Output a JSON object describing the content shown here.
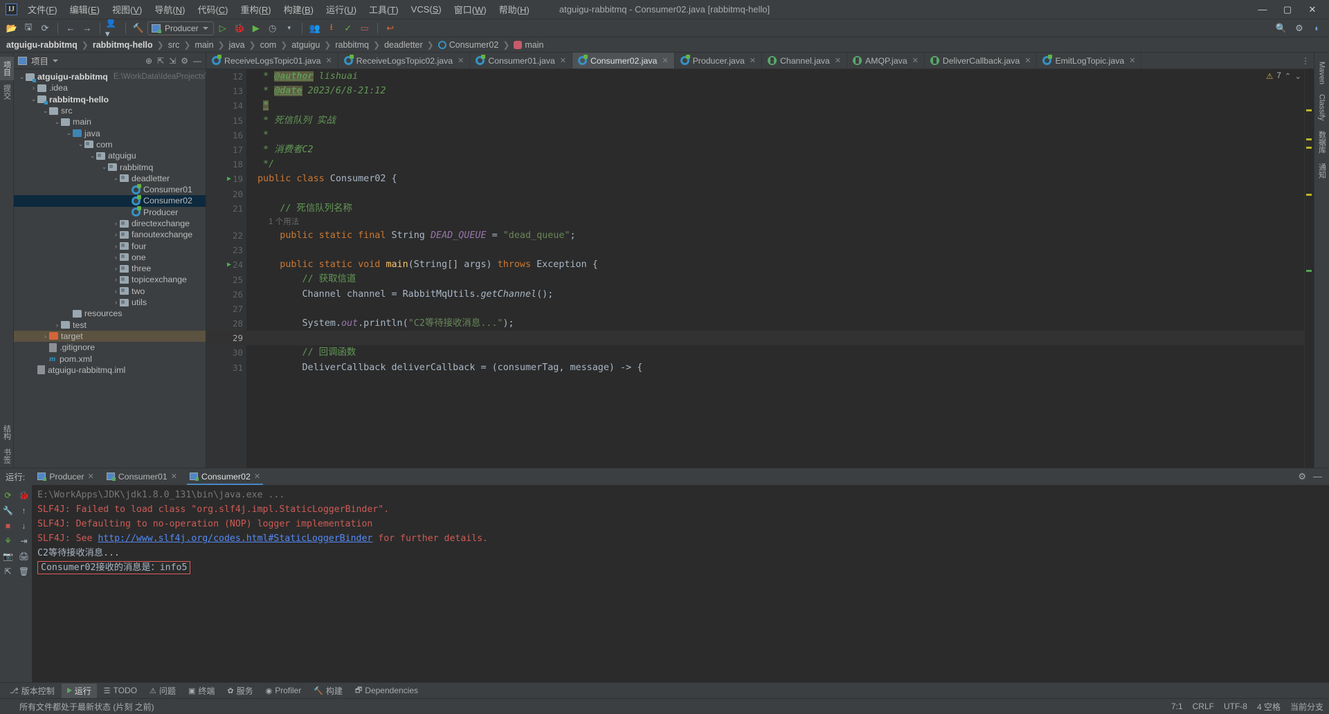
{
  "titlebar": {
    "logo": "IJ",
    "menus": [
      "文件(F)",
      "编辑(E)",
      "视图(V)",
      "导航(N)",
      "代码(C)",
      "重构(R)",
      "构建(B)",
      "运行(U)",
      "工具(T)",
      "VCS(S)",
      "窗口(W)",
      "帮助(H)"
    ],
    "window_title": "atguigu-rabbitmq - Consumer02.java [rabbitmq-hello]",
    "minimize": "—",
    "maximize": "▢",
    "close": "✕"
  },
  "toolbar": {
    "run_config": "Producer",
    "icons": [
      "open-folder-icon",
      "save-icon",
      "sync-icon",
      "back-arrow-icon",
      "forward-arrow-icon",
      "user-icon",
      "build-hammer-icon"
    ],
    "right_icons": [
      "search-icon",
      "settings-gear-icon",
      "account-icon"
    ]
  },
  "breadcrumb": {
    "items": [
      {
        "label": "atguigu-rabbitmq",
        "bold": true
      },
      {
        "label": "rabbitmq-hello",
        "bold": true
      },
      {
        "label": "src",
        "bold": false
      },
      {
        "label": "main",
        "bold": false
      },
      {
        "label": "java",
        "bold": false
      },
      {
        "label": "com",
        "bold": false
      },
      {
        "label": "atguigu",
        "bold": false
      },
      {
        "label": "rabbitmq",
        "bold": false
      },
      {
        "label": "deadletter",
        "bold": false
      },
      {
        "label": "Consumer02",
        "bold": false,
        "icon": "class-icon"
      },
      {
        "label": "main",
        "bold": false,
        "icon": "method-icon"
      }
    ]
  },
  "left_strip": {
    "tabs": [
      "项目",
      "提交"
    ],
    "bottom": [
      "结构",
      "书签"
    ]
  },
  "right_strip": {
    "tabs": [
      "Maven",
      "Classify",
      "数据库",
      "通知"
    ]
  },
  "project_panel": {
    "title": "项目",
    "tools": [
      "collapse-icon",
      "expand-icon",
      "settings-icon",
      "minimize-icon"
    ],
    "tree": [
      {
        "depth": 0,
        "arrow": "v",
        "icon": "module-folder",
        "label": "atguigu-rabbitmq",
        "bold": true,
        "path": "E:\\WorkData\\IdeaProjects\\Ra"
      },
      {
        "depth": 1,
        "arrow": ">",
        "icon": "folder",
        "label": ".idea",
        "bold": false
      },
      {
        "depth": 1,
        "arrow": "v",
        "icon": "module-folder",
        "label": "rabbitmq-hello",
        "bold": true
      },
      {
        "depth": 2,
        "arrow": "v",
        "icon": "folder",
        "label": "src",
        "bold": false
      },
      {
        "depth": 3,
        "arrow": "v",
        "icon": "folder",
        "label": "main",
        "bold": false
      },
      {
        "depth": 4,
        "arrow": "v",
        "icon": "source-folder",
        "label": "java",
        "bold": false
      },
      {
        "depth": 5,
        "arrow": "v",
        "icon": "package",
        "label": "com",
        "bold": false
      },
      {
        "depth": 6,
        "arrow": "v",
        "icon": "package",
        "label": "atguigu",
        "bold": false
      },
      {
        "depth": 7,
        "arrow": "v",
        "icon": "package",
        "label": "rabbitmq",
        "bold": false
      },
      {
        "depth": 8,
        "arrow": "v",
        "icon": "package",
        "label": "deadletter",
        "bold": false
      },
      {
        "depth": 9,
        "arrow": "",
        "icon": "class",
        "label": "Consumer01",
        "bold": false
      },
      {
        "depth": 9,
        "arrow": "",
        "icon": "class",
        "label": "Consumer02",
        "bold": false,
        "selected": true
      },
      {
        "depth": 9,
        "arrow": "",
        "icon": "class",
        "label": "Producer",
        "bold": false
      },
      {
        "depth": 8,
        "arrow": ">",
        "icon": "package",
        "label": "directexchange",
        "bold": false
      },
      {
        "depth": 8,
        "arrow": ">",
        "icon": "package",
        "label": "fanoutexchange",
        "bold": false
      },
      {
        "depth": 8,
        "arrow": ">",
        "icon": "package",
        "label": "four",
        "bold": false
      },
      {
        "depth": 8,
        "arrow": ">",
        "icon": "package",
        "label": "one",
        "bold": false
      },
      {
        "depth": 8,
        "arrow": ">",
        "icon": "package",
        "label": "three",
        "bold": false
      },
      {
        "depth": 8,
        "arrow": ">",
        "icon": "package",
        "label": "topicexchange",
        "bold": false
      },
      {
        "depth": 8,
        "arrow": ">",
        "icon": "package",
        "label": "two",
        "bold": false
      },
      {
        "depth": 8,
        "arrow": ">",
        "icon": "package",
        "label": "utils",
        "bold": false
      },
      {
        "depth": 4,
        "arrow": "",
        "icon": "resource-folder",
        "label": "resources",
        "bold": false
      },
      {
        "depth": 3,
        "arrow": ">",
        "icon": "folder",
        "label": "test",
        "bold": false
      },
      {
        "depth": 2,
        "arrow": ">",
        "icon": "target-folder",
        "label": "target",
        "bold": false,
        "highlight": true
      },
      {
        "depth": 2,
        "arrow": "",
        "icon": "gitignore-file",
        "label": ".gitignore",
        "bold": false
      },
      {
        "depth": 2,
        "arrow": "",
        "icon": "maven-file",
        "label": "pom.xml",
        "bold": false
      },
      {
        "depth": 1,
        "arrow": "",
        "icon": "iml-file",
        "label": "atguigu-rabbitmq.iml",
        "bold": false
      }
    ]
  },
  "editor": {
    "tabs": [
      {
        "label": "ReceiveLogsTopic01.java",
        "icon": "class-icon",
        "active": false
      },
      {
        "label": "ReceiveLogsTopic02.java",
        "icon": "class-icon",
        "active": false
      },
      {
        "label": "Consumer01.java",
        "icon": "class-icon",
        "active": false
      },
      {
        "label": "Consumer02.java",
        "icon": "class-icon",
        "active": true
      },
      {
        "label": "Producer.java",
        "icon": "class-icon",
        "active": false
      },
      {
        "label": "Channel.java",
        "icon": "interface-icon",
        "active": false
      },
      {
        "label": "AMQP.java",
        "icon": "interface-icon",
        "active": false
      },
      {
        "label": "DeliverCallback.java",
        "icon": "interface-icon",
        "active": false
      },
      {
        "label": "EmitLogTopic.java",
        "icon": "class-icon",
        "active": false
      }
    ],
    "warning_count": "7",
    "lines": [
      {
        "num": "12",
        "type": "code"
      },
      {
        "num": "13",
        "type": "code"
      },
      {
        "num": "14",
        "type": "code"
      },
      {
        "num": "15",
        "type": "code"
      },
      {
        "num": "16",
        "type": "code"
      },
      {
        "num": "17",
        "type": "code"
      },
      {
        "num": "18",
        "type": "code"
      },
      {
        "num": "19",
        "type": "code",
        "run": true
      },
      {
        "num": "20",
        "type": "code"
      },
      {
        "num": "21",
        "type": "code"
      },
      {
        "num": "",
        "type": "usage"
      },
      {
        "num": "22",
        "type": "code"
      },
      {
        "num": "23",
        "type": "code"
      },
      {
        "num": "24",
        "type": "code",
        "run": true
      },
      {
        "num": "25",
        "type": "code"
      },
      {
        "num": "26",
        "type": "code"
      },
      {
        "num": "27",
        "type": "code"
      },
      {
        "num": "28",
        "type": "code"
      },
      {
        "num": "29",
        "type": "code",
        "current": true
      },
      {
        "num": "30",
        "type": "code"
      },
      {
        "num": "31",
        "type": "code"
      }
    ],
    "usage_hint": "1 个用法",
    "code_text": [
      " * @author lishuai",
      " * @date 2023/6/8-21:12",
      " *",
      " * 死信队列 实战",
      " *",
      " * 消费者C2",
      " */",
      "public class Consumer02 {",
      "",
      "    // 死信队列名称",
      "    public static final String DEAD_QUEUE = \"dead_queue\";",
      "",
      "    public static void main(String[] args) throws Exception {",
      "        // 获取信道",
      "        Channel channel = RabbitMqUtils.getChannel();",
      "",
      "        System.out.println(\"C2等待接收消息...\");",
      "",
      "        // 回调函数",
      "        DeliverCallback deliverCallback = (consumerTag, message) -> {"
    ]
  },
  "run_panel": {
    "label": "运行:",
    "tabs": [
      {
        "label": "Producer",
        "active": false
      },
      {
        "label": "Consumer01",
        "active": false
      },
      {
        "label": "Consumer02",
        "active": true
      }
    ],
    "side_icons": [
      "rerun-icon",
      "debug-icon",
      "wrench-icon",
      "scroll-up-icon",
      "stop-icon",
      "scroll-down-icon",
      "filter-icon",
      "soft-wrap-icon",
      "camera-icon",
      "print-icon",
      "export-icon",
      "trash-icon"
    ],
    "console": [
      {
        "kind": "dim",
        "text": "E:\\WorkApps\\JDK\\jdk1.8.0_131\\bin\\java.exe ..."
      },
      {
        "kind": "err",
        "text": "SLF4J: Failed to load class \"org.slf4j.impl.StaticLoggerBinder\"."
      },
      {
        "kind": "err",
        "text": "SLF4J: Defaulting to no-operation (NOP) logger implementation"
      },
      {
        "kind": "err-link",
        "prefix": "SLF4J: See ",
        "link": "http://www.slf4j.org/codes.html#StaticLoggerBinder",
        "suffix": " for further details."
      },
      {
        "kind": "plain",
        "text": "C2等待接收消息..."
      },
      {
        "kind": "boxed",
        "text": "Consumer02接收的消息是：info5"
      }
    ]
  },
  "tool_window_bar": {
    "items": [
      {
        "label": "版本控制",
        "icon": "vcs-icon",
        "active": false
      },
      {
        "label": "运行",
        "icon": "run-icon",
        "active": true
      },
      {
        "label": "TODO",
        "icon": "todo-icon",
        "active": false
      },
      {
        "label": "问题",
        "icon": "problems-icon",
        "active": false
      },
      {
        "label": "终端",
        "icon": "terminal-icon",
        "active": false
      },
      {
        "label": "服务",
        "icon": "services-icon",
        "active": false
      },
      {
        "label": "Profiler",
        "icon": "profiler-icon",
        "active": false
      },
      {
        "label": "构建",
        "icon": "build-icon",
        "active": false
      },
      {
        "label": "Dependencies",
        "icon": "dependencies-icon",
        "active": false
      }
    ]
  },
  "status_bar": {
    "message": "所有文件都处于最新状态 (片刻 之前)",
    "caret": "7:1",
    "line_sep": "CRLF",
    "encoding": "UTF-8",
    "indent": "4 空格",
    "branch": "当前分支"
  }
}
